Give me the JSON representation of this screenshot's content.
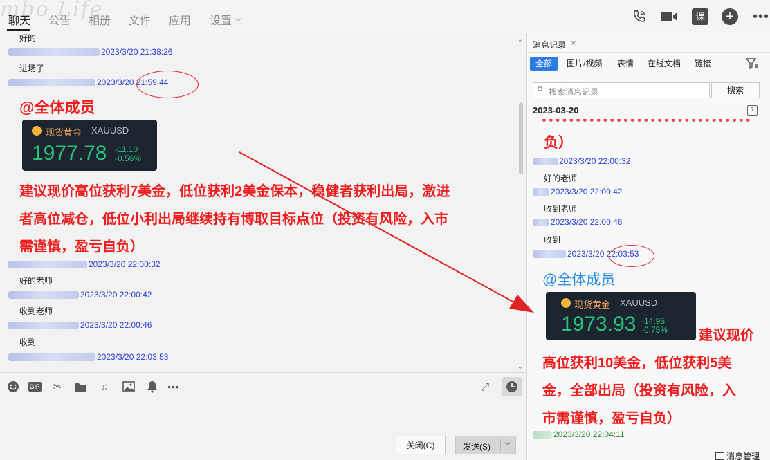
{
  "watermark": "mbo Life",
  "tabs": [
    {
      "label": "聊天"
    },
    {
      "label": "公告"
    },
    {
      "label": "相册"
    },
    {
      "label": "文件"
    },
    {
      "label": "应用"
    },
    {
      "label": "设置"
    }
  ],
  "header_icons": {
    "lesson": "课"
  },
  "chat": {
    "messages": [
      {
        "text": "好的"
      },
      {
        "time": "2023/3/20 21:38:26",
        "text": "进场了"
      },
      {
        "time": "2023/3/20 21:59:44"
      }
    ],
    "announcement": {
      "mention": "@全体成员",
      "card": {
        "name": "现货黄金",
        "symbol": "XAUUSD",
        "price": "1977.78",
        "change": "-11.10",
        "change_pct": "-0.56%"
      },
      "lines": [
        "建议现价高位获利7美金，低位获利2美金保本，稳健者获利出局，激进",
        "者高位减仓，低位小利出局继续持有博取目标点位（投资有风险，入市",
        "需谨慎，盈亏自负）"
      ]
    },
    "followups": [
      {
        "time": "2023/3/20 22:00:32",
        "text": "好的老师"
      },
      {
        "time": "2023/3/20 22:00:42",
        "text": "收到老师"
      },
      {
        "time": "2023/3/20 22:00:46",
        "text": "收到"
      },
      {
        "time": "2023/3/20 22:03:53"
      }
    ]
  },
  "input": {
    "close_label": "关闭(C)",
    "send_label": "发送(S)"
  },
  "panel": {
    "title": "消息记录",
    "filters": [
      "全部",
      "图片/视频",
      "表情",
      "在线文档",
      "链接"
    ],
    "search_placeholder": "搜索消息记录",
    "search_button": "搜索",
    "date": "2023-03-20",
    "calendar_day": "7",
    "top_fragment": "负）",
    "messages": [
      {
        "time": "2023/3/20 22:00:32",
        "text": "好的老师"
      },
      {
        "time": "2023/3/20 22:00:42",
        "text": "收到老师"
      },
      {
        "time": "2023/3/20 22:00:46",
        "text": "收到"
      },
      {
        "time": "2023/3/20 22:03:53"
      }
    ],
    "mention": "@全体成员",
    "card": {
      "name": "现货黄金",
      "symbol": "XAUUSD",
      "price": "1973.93",
      "change": "-14.95",
      "change_pct": "-0.75%"
    },
    "lines": [
      "建议现价",
      "高位获利10美金，低位获利5美",
      "金，全部出局（投资有风险，入",
      "市需谨慎，盈亏自负）"
    ],
    "last_time": "2023/3/20 22:04:11",
    "manage_label": "消息管理"
  },
  "colors": {
    "accent": "#2e7be4",
    "alert_red": "#ee1c1c",
    "gain_green": "#27c27c",
    "card_bg": "#1c2430"
  }
}
